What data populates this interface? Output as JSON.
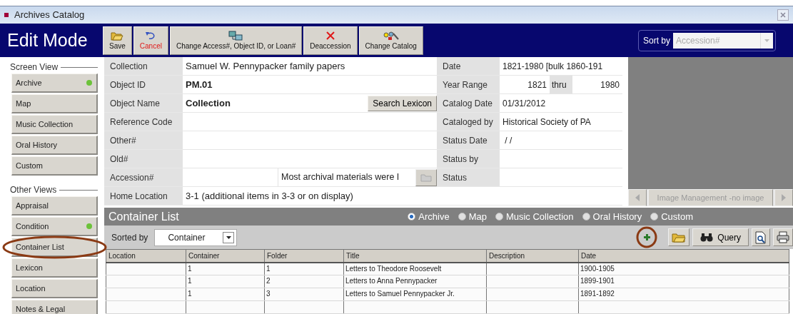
{
  "window": {
    "title": "Archives Catalog"
  },
  "mode": "Edit Mode",
  "toolbar": [
    {
      "kind": "save",
      "label": "Save"
    },
    {
      "kind": "cancel",
      "label": "Cancel"
    },
    {
      "kind": "change-id",
      "label": "Change Access#, Object ID, or Loan#"
    },
    {
      "kind": "deaccession",
      "label": "Deaccession"
    },
    {
      "kind": "change-catalog",
      "label": "Change Catalog"
    }
  ],
  "sort": {
    "label": "Sort by",
    "placeholder": "Accession#"
  },
  "sidebar": {
    "sections": [
      {
        "title": "Screen View",
        "items": [
          {
            "label": "Archive",
            "marked": true,
            "highlighted": false
          },
          {
            "label": "Map",
            "marked": false,
            "highlighted": false
          },
          {
            "label": "Music Collection",
            "marked": false,
            "highlighted": false
          },
          {
            "label": "Oral History",
            "marked": false,
            "highlighted": false
          },
          {
            "label": "Custom",
            "marked": false,
            "highlighted": false
          }
        ]
      },
      {
        "title": "Other Views",
        "items": [
          {
            "label": "Appraisal",
            "marked": false,
            "highlighted": false
          },
          {
            "label": "Condition",
            "marked": true,
            "highlighted": false
          },
          {
            "label": "Container List",
            "marked": false,
            "highlighted": true
          },
          {
            "label": "Lexicon",
            "marked": false,
            "highlighted": false
          },
          {
            "label": "Location",
            "marked": false,
            "highlighted": false
          },
          {
            "label": "Notes & Legal",
            "marked": false,
            "highlighted": false
          }
        ]
      }
    ]
  },
  "form": {
    "left": [
      {
        "label": "Collection",
        "value": "Samuel W. Pennypacker family papers",
        "bold": false
      },
      {
        "label": "Object ID",
        "value": "PM.01",
        "bold": true
      },
      {
        "label": "Object Name",
        "value": "Collection",
        "bold": true,
        "button": "Search Lexicon"
      },
      {
        "label": "Reference Code"
      },
      {
        "label": "Other#"
      },
      {
        "label": "Old#"
      },
      {
        "label": "Accession#",
        "note": "Most archival materials were I"
      },
      {
        "label": "Home Location",
        "value": "3-1 (additional items in 3-3 or on display)",
        "bold": false
      }
    ],
    "right": [
      {
        "kind": "text",
        "label": "Date",
        "value": "1821-1980 [bulk 1860-191"
      },
      {
        "kind": "range",
        "label": "Year Range",
        "from": "1821",
        "separator": "thru",
        "to": "1980"
      },
      {
        "kind": "text",
        "label": "Catalog Date",
        "value": "01/31/2012"
      },
      {
        "kind": "text",
        "label": "Cataloged by",
        "value": "Historical Society of PA"
      },
      {
        "kind": "text",
        "label": "Status Date",
        "value": " / /"
      },
      {
        "kind": "text",
        "label": "Status by"
      },
      {
        "kind": "text",
        "label": "Status"
      }
    ]
  },
  "image_panel": {
    "caption": "Image Management -no image"
  },
  "container_list": {
    "title": "Container List",
    "filters": [
      {
        "label": "Archive",
        "selected": true
      },
      {
        "label": "Map",
        "selected": false
      },
      {
        "label": "Music Collection",
        "selected": false
      },
      {
        "label": "Oral History",
        "selected": false
      },
      {
        "label": "Custom",
        "selected": false
      }
    ],
    "sorted": {
      "label": "Sorted by",
      "value": "Container"
    },
    "actions": [
      {
        "kind": "add",
        "highlighted": true
      },
      {
        "kind": "open",
        "highlighted": false
      },
      {
        "kind": "query",
        "label": "Query",
        "highlighted": false
      },
      {
        "kind": "preview",
        "highlighted": false
      },
      {
        "kind": "print",
        "highlighted": false
      }
    ],
    "columns": [
      "Location",
      "Container",
      "Folder",
      "Title",
      "Description",
      "Date"
    ],
    "rows": [
      [
        "",
        "1",
        "1",
        "Letters to Theodore Roosevelt",
        "",
        "1900-1905"
      ],
      [
        "",
        "1",
        "2",
        "Letters to Anna Pennypacker",
        "",
        "1899-1901"
      ],
      [
        "",
        "1",
        "3",
        "Letters to Samuel Pennypacker Jr.",
        "",
        "1891-1892"
      ]
    ]
  }
}
